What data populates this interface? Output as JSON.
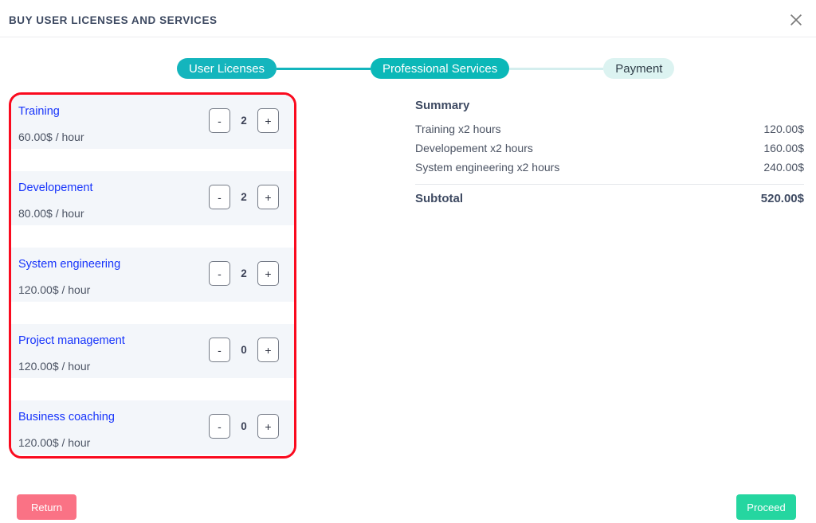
{
  "header": {
    "title": "BUY USER LICENSES AND SERVICES",
    "close_icon": "close-icon"
  },
  "steps": [
    {
      "label": "User Licenses",
      "state": "done"
    },
    {
      "label": "Professional Services",
      "state": "active"
    },
    {
      "label": "Payment",
      "state": "upcoming"
    }
  ],
  "products": [
    {
      "name": "Training",
      "price": "60.00$ / hour",
      "qty": "2",
      "minus": "-",
      "plus": "+"
    },
    {
      "name": "Developement",
      "price": "80.00$ / hour",
      "qty": "2",
      "minus": "-",
      "plus": "+"
    },
    {
      "name": "System engineering",
      "price": "120.00$ / hour",
      "qty": "2",
      "minus": "-",
      "plus": "+"
    },
    {
      "name": "Project management",
      "price": "120.00$ / hour",
      "qty": "0",
      "minus": "-",
      "plus": "+"
    },
    {
      "name": "Business coaching",
      "price": "120.00$ / hour",
      "qty": "0",
      "minus": "-",
      "plus": "+"
    }
  ],
  "summary": {
    "title": "Summary",
    "lines": [
      {
        "label": "Training x2 hours",
        "amount": "120.00$"
      },
      {
        "label": "Developement x2 hours",
        "amount": "160.00$"
      },
      {
        "label": "System engineering x2 hours",
        "amount": "240.00$"
      }
    ],
    "subtotal_label": "Subtotal",
    "subtotal_amount": "520.00$"
  },
  "footer": {
    "return_label": "Return",
    "proceed_label": "Proceed"
  },
  "colors": {
    "step_done": "#14b5bd",
    "step_active": "#0bb8b8",
    "step_upcoming_bg": "#dcf3f1",
    "product_link": "#1734fb",
    "highlight_border": "#fa0a1e",
    "return_bg": "#fa7285",
    "proceed_bg": "#25d6a0",
    "title": "#3e4a62"
  }
}
